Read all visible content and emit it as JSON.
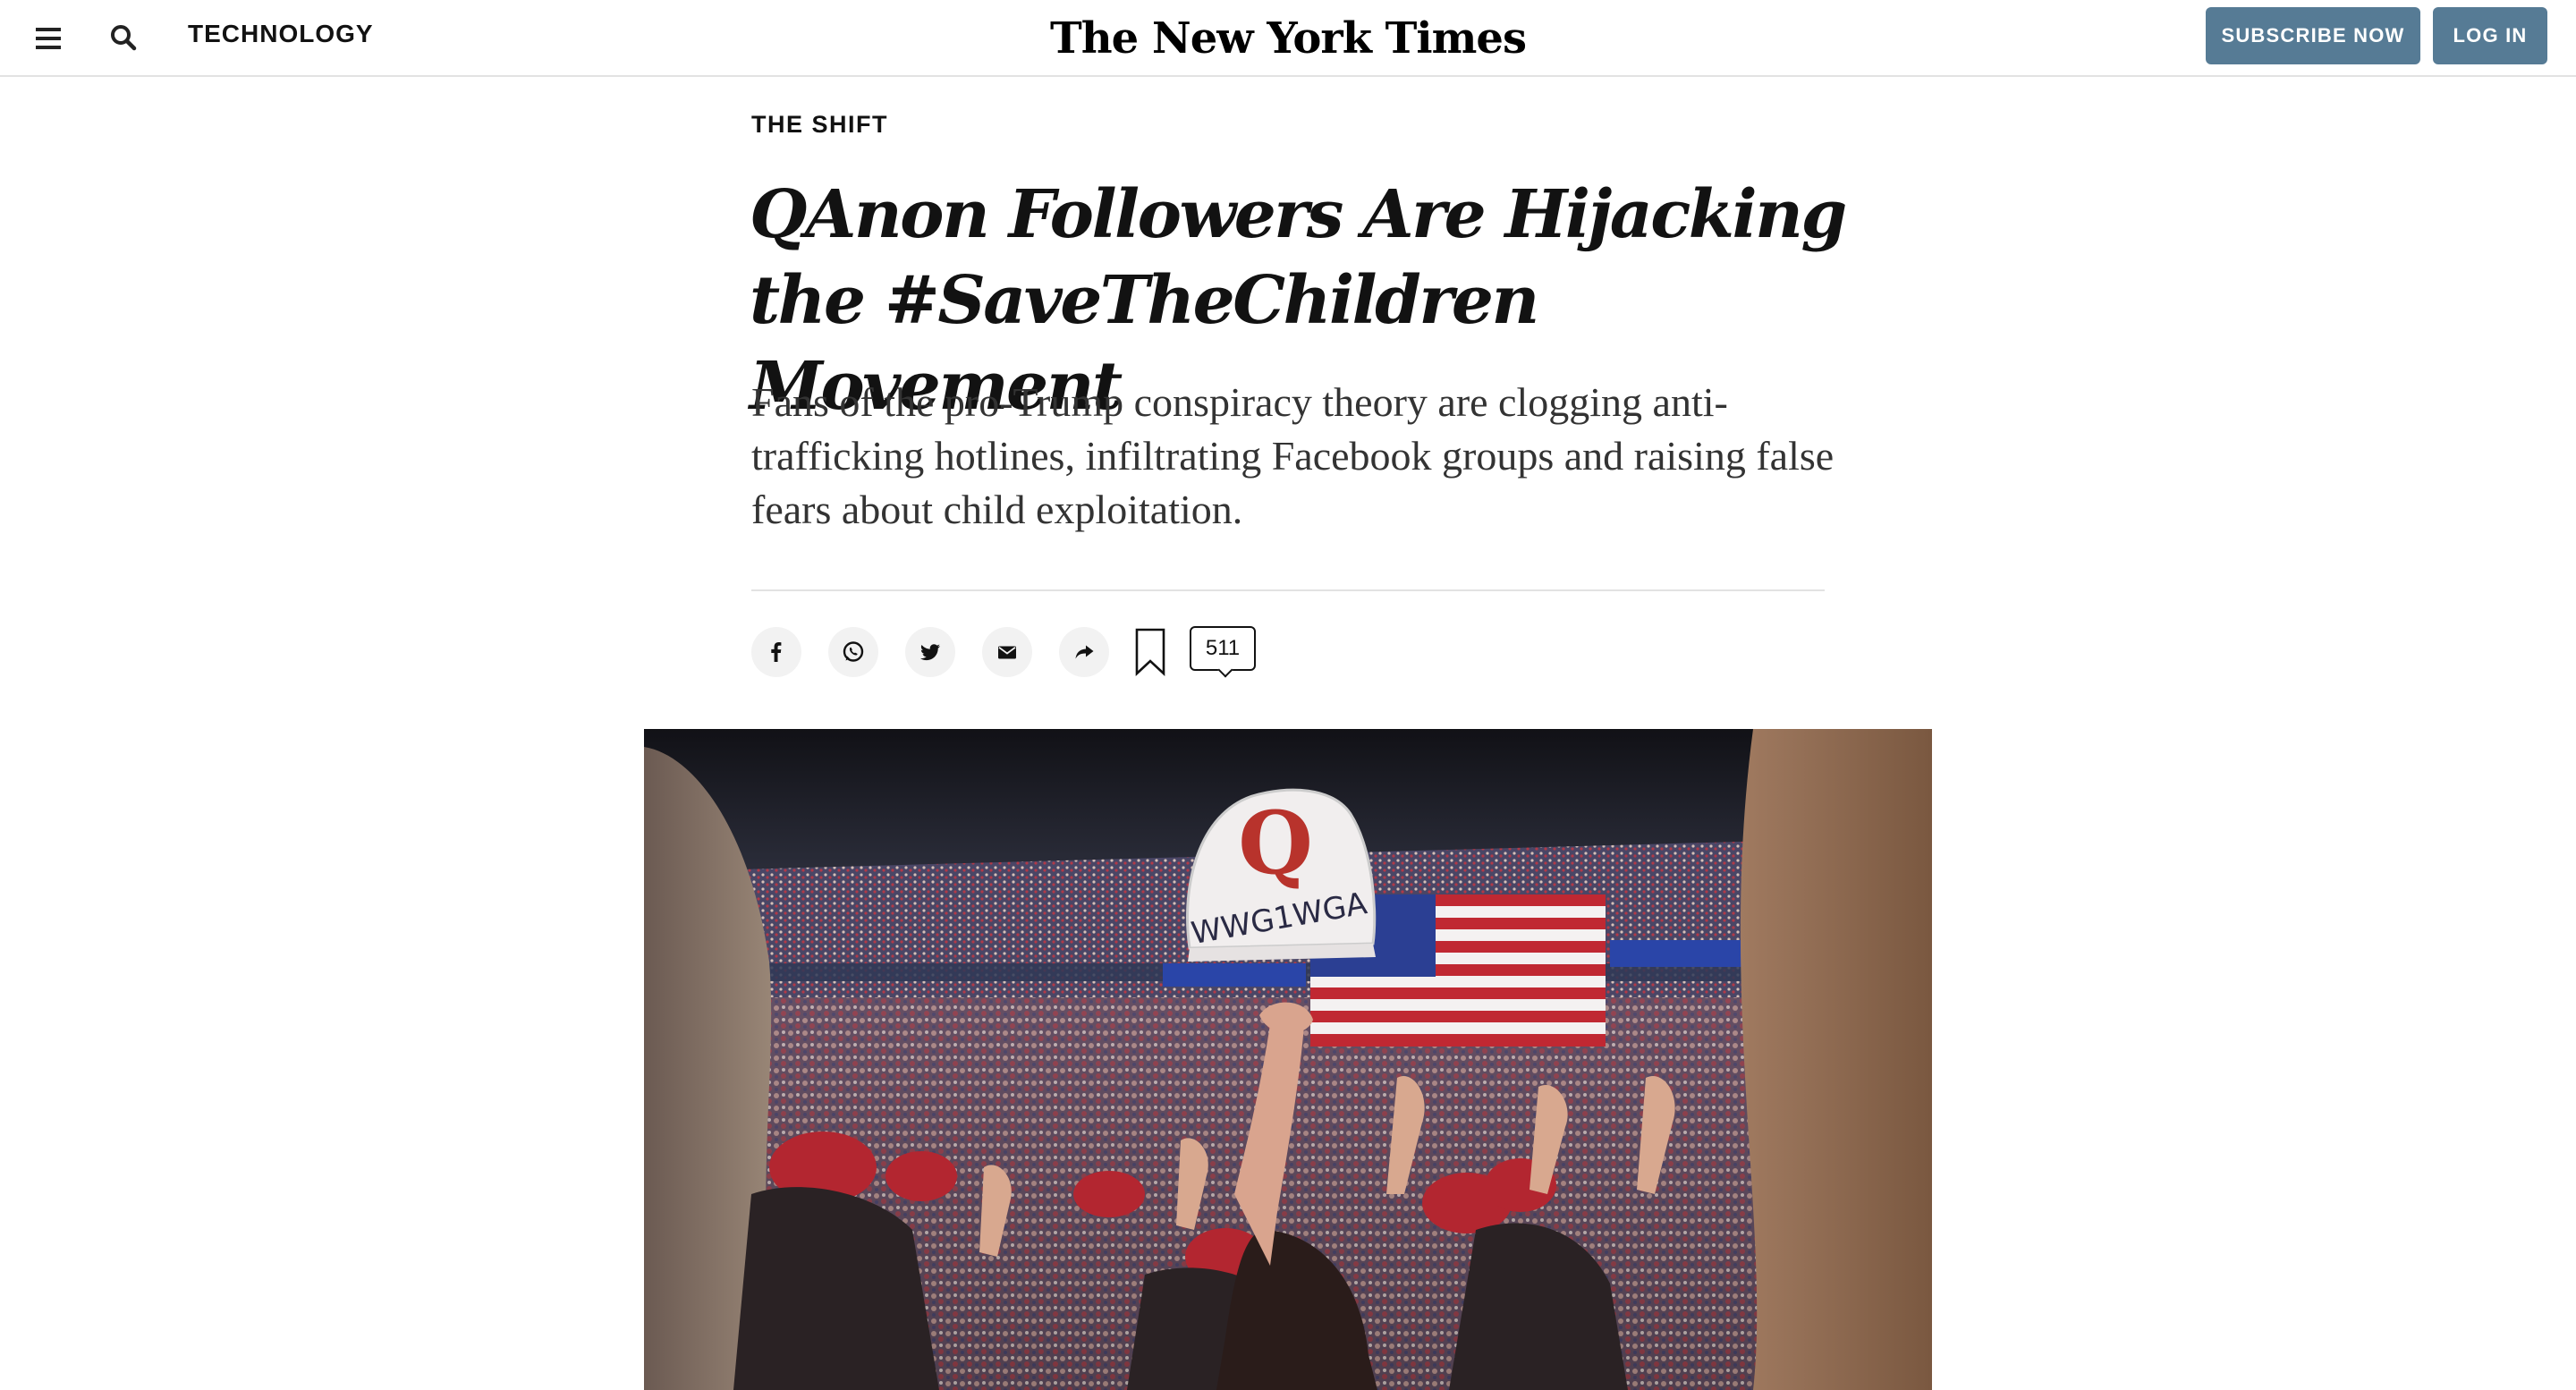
{
  "topbar": {
    "menu_icon": "hamburger-menu-icon",
    "search_icon": "search-icon",
    "section_label": "TECHNOLOGY",
    "logo_text": "The New York Times",
    "subscribe_label": "SUBSCRIBE NOW",
    "login_label": "LOG IN"
  },
  "article": {
    "kicker": "THE SHIFT",
    "headline": "QAnon Followers Are Hijacking the #SaveTheChildren Movement",
    "summary": "Fans of the pro-Trump conspiracy theory are clogging anti-trafficking hotlines, infiltrating Facebook groups and raising false fears about child exploitation.",
    "comment_count": "511"
  },
  "share_tools": [
    {
      "icon": "facebook-icon"
    },
    {
      "icon": "whatsapp-icon"
    },
    {
      "icon": "twitter-icon"
    },
    {
      "icon": "email-icon"
    },
    {
      "icon": "share-arrow-icon"
    },
    {
      "icon": "bookmark-icon"
    },
    {
      "icon": "comment-bubble-icon"
    }
  ],
  "hero_image": {
    "hat_lettering": "WWG1WGA",
    "hat_letter": "Q"
  },
  "colors": {
    "button_bg": "#567b95",
    "text": "#121212",
    "rule": "#e2e2e2"
  }
}
